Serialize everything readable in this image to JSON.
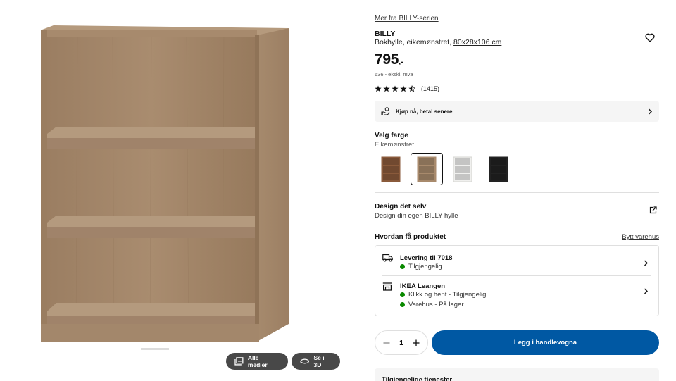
{
  "media": {
    "all_media_label": "Alle medier",
    "view_3d_label": "Se i 3D"
  },
  "product": {
    "series_link": "Mer fra BILLY-serien",
    "name": "BILLY",
    "description": "Bokhylle, eikemønstret,",
    "dimensions": "80x28x106 cm",
    "price": "795",
    "price_suffix": ",-",
    "price_ex_vat": "636,- ekskl. mva",
    "rating_stars": 4.5,
    "rating_max": 5,
    "review_count": "(1415)"
  },
  "pay_later": {
    "label": "Kjøp nå, betal senere"
  },
  "color": {
    "title": "Velg farge",
    "selected": "Eikemønstret",
    "swatches": [
      {
        "name": "brown",
        "color": "#8a5a3b",
        "selected": false
      },
      {
        "name": "oak",
        "color": "#a88a6c",
        "selected": true
      },
      {
        "name": "white",
        "color": "#f0f0ee",
        "selected": false
      },
      {
        "name": "black",
        "color": "#222222",
        "selected": false
      }
    ]
  },
  "design": {
    "title": "Design det selv",
    "subtitle": "Design din egen BILLY hylle"
  },
  "delivery": {
    "title": "Hvordan få produktet",
    "change_store": "Bytt varehus",
    "home": {
      "title": "Levering til 7018",
      "status": "Tilgjengelig"
    },
    "store": {
      "title": "IKEA Leangen",
      "status_1": "Klikk og hent - Tilgjengelig",
      "status_2": "Varehus - På lager"
    }
  },
  "cart": {
    "quantity": "1",
    "add_label": "Legg i handlevogna"
  },
  "services": {
    "label": "Tilgjengelige tjenester"
  },
  "colors": {
    "accent": "#0058a3",
    "available": "#0a8a00",
    "wood": "#a88a6c"
  }
}
